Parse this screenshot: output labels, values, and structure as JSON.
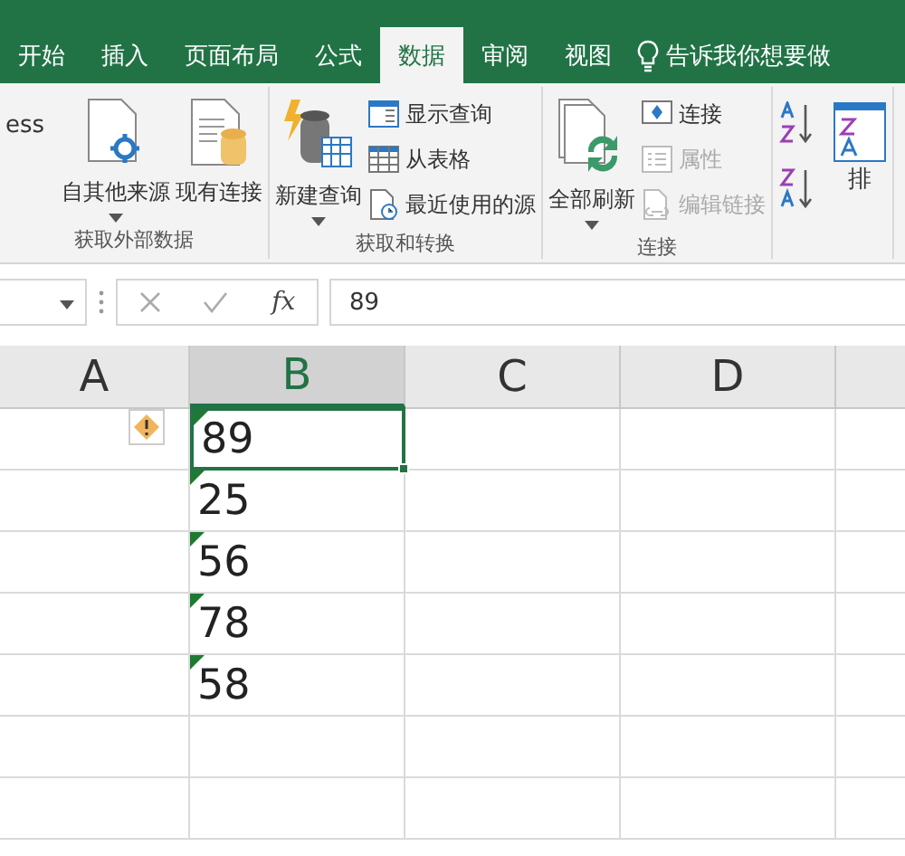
{
  "tabs": [
    {
      "label": "开始",
      "selected": false
    },
    {
      "label": "插入",
      "selected": false
    },
    {
      "label": "页面布局",
      "selected": false
    },
    {
      "label": "公式",
      "selected": false
    },
    {
      "label": "数据",
      "selected": true
    },
    {
      "label": "审阅",
      "selected": false
    },
    {
      "label": "视图",
      "selected": false
    }
  ],
  "tell_me": {
    "text": "告诉我你想要做"
  },
  "ribbon": {
    "groups": [
      {
        "label": "获取外部数据",
        "items": [
          {
            "kind": "cut",
            "label": "ess"
          },
          {
            "kind": "large",
            "label": "自其他来源",
            "dropdown": true,
            "disabled": false
          },
          {
            "kind": "large",
            "label": "现有连接",
            "dropdown": false,
            "disabled": false
          }
        ]
      },
      {
        "label": "获取和转换",
        "items": [
          {
            "kind": "large",
            "label": "新建查询",
            "dropdown": true,
            "disabled": false
          },
          {
            "kind": "small",
            "label": "显示查询",
            "disabled": false
          },
          {
            "kind": "small",
            "label": "从表格",
            "disabled": false
          },
          {
            "kind": "small",
            "label": "最近使用的源",
            "disabled": false
          }
        ]
      },
      {
        "label": "连接",
        "items": [
          {
            "kind": "large",
            "label": "全部刷新",
            "dropdown": true,
            "disabled": false
          },
          {
            "kind": "small",
            "label": "连接",
            "disabled": false
          },
          {
            "kind": "small",
            "label": "属性",
            "disabled": true
          },
          {
            "kind": "small",
            "label": "编辑链接",
            "disabled": true
          }
        ]
      },
      {
        "items": [
          {
            "kind": "sort",
            "label": "排"
          }
        ]
      }
    ]
  },
  "formula_bar": {
    "fx_label": "fx",
    "value": "89"
  },
  "columns": [
    {
      "label": "A",
      "selected": false
    },
    {
      "label": "B",
      "selected": true
    },
    {
      "label": "C",
      "selected": false
    },
    {
      "label": "D",
      "selected": false
    }
  ],
  "rows": [
    {
      "value": "89",
      "selected": true,
      "number_as_text": true,
      "warning_tag": true
    },
    {
      "value": "25",
      "selected": false,
      "number_as_text": true,
      "warning_tag": false
    },
    {
      "value": "56",
      "selected": false,
      "number_as_text": true,
      "warning_tag": false
    },
    {
      "value": "78",
      "selected": false,
      "number_as_text": true,
      "warning_tag": false
    },
    {
      "value": "58",
      "selected": false,
      "number_as_text": true,
      "warning_tag": false
    }
  ]
}
